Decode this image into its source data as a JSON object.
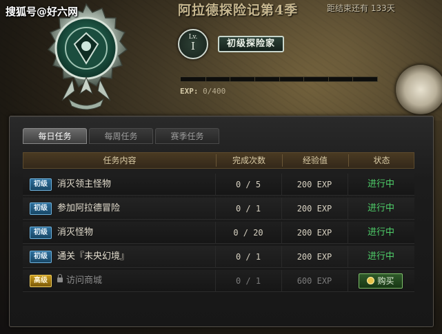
{
  "watermark": "搜狐号@好六网",
  "header": {
    "season_title": "阿拉德探险记第4季",
    "days_left": "距结束还有 133天",
    "level_label": "Lv.",
    "level_value": "I",
    "rank_title": "初级探险家",
    "exp_label": "EXP:",
    "exp_value": "0/400",
    "exp_progress": 0
  },
  "tabs": [
    {
      "label": "每日任务",
      "active": true
    },
    {
      "label": "每周任务",
      "active": false
    },
    {
      "label": "赛季任务",
      "active": false
    }
  ],
  "table": {
    "columns": [
      "任务内容",
      "完成次数",
      "经验值",
      "状态"
    ],
    "rows": [
      {
        "level": "初级",
        "level_type": "basic",
        "task": "消灭领主怪物",
        "count": "0 / 5",
        "exp": "200 EXP",
        "status": "进行中",
        "locked": false
      },
      {
        "level": "初级",
        "level_type": "basic",
        "task": "参加阿拉德冒险",
        "count": "0 / 1",
        "exp": "200 EXP",
        "status": "进行中",
        "locked": false
      },
      {
        "level": "初级",
        "level_type": "basic",
        "task": "消灭怪物",
        "count": "0 / 20",
        "exp": "200 EXP",
        "status": "进行中",
        "locked": false
      },
      {
        "level": "初级",
        "level_type": "basic",
        "task": "通关『未央幻境』",
        "count": "0 / 1",
        "exp": "200 EXP",
        "status": "进行中",
        "locked": false
      },
      {
        "level": "高级",
        "level_type": "advanced",
        "task": "访问商城",
        "count": "0 / 1",
        "exp": "600 EXP",
        "status": "购买",
        "locked": true
      }
    ]
  },
  "colors": {
    "status_in_progress": "#4fd06a",
    "basic_badge": "#2d6f9c",
    "advanced_badge": "#c99a1a",
    "buy_button": "#2f5a2a"
  },
  "icons": {
    "emblem": "season-emblem-icon",
    "lock": "lock-icon",
    "coin": "coin-icon"
  }
}
